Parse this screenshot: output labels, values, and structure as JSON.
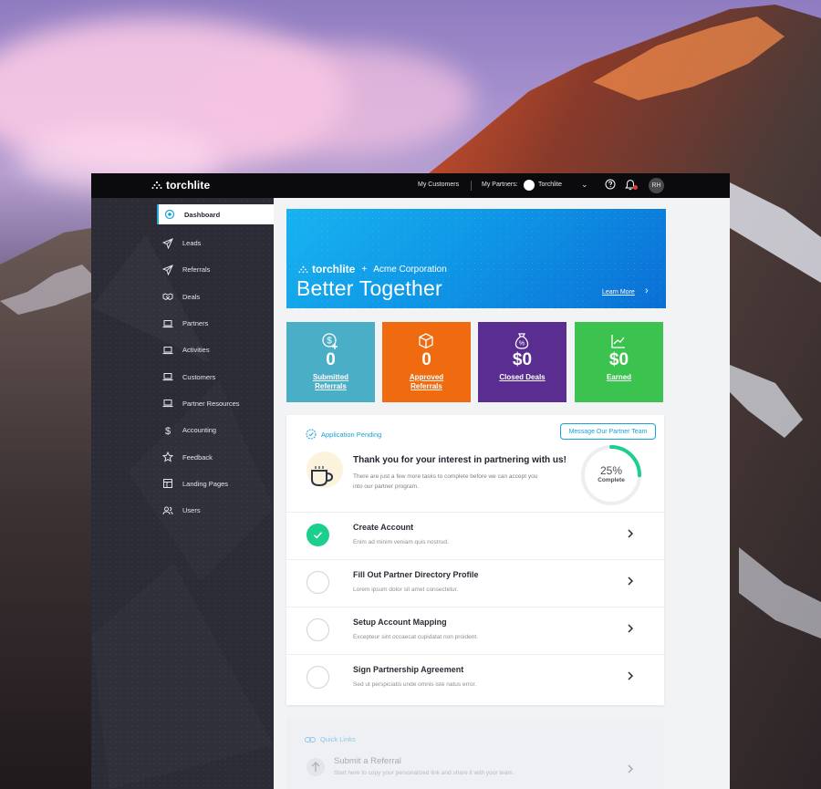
{
  "topbar": {
    "brand": "torchlite",
    "my_customers": "My Customers",
    "my_partners_label": "My Partners:",
    "partner_name": "Torchlite",
    "avatar_initials": "RH"
  },
  "sidebar": {
    "items": [
      {
        "label": "Dashboard",
        "icon": "dashboard-icon",
        "active": true
      },
      {
        "label": "Leads",
        "icon": "send-icon"
      },
      {
        "label": "Referrals",
        "icon": "send-icon"
      },
      {
        "label": "Deals",
        "icon": "handshake-icon"
      },
      {
        "label": "Partners",
        "icon": "laptop-icon"
      },
      {
        "label": "Activities",
        "icon": "laptop-icon"
      },
      {
        "label": "Customers",
        "icon": "laptop-icon"
      },
      {
        "label": "Partner Resources",
        "icon": "laptop-icon"
      },
      {
        "label": "Accounting",
        "icon": "dollar-icon"
      },
      {
        "label": "Feedback",
        "icon": "star-icon"
      },
      {
        "label": "Landing Pages",
        "icon": "layout-icon"
      },
      {
        "label": "Users",
        "icon": "users-icon"
      }
    ]
  },
  "banner": {
    "brand": "torchlite",
    "plus": "+",
    "partner": "Acme Corporation",
    "title": "Better Together",
    "learn_more": "Learn More"
  },
  "stats": [
    {
      "value": "0",
      "label": "Submitted Referrals",
      "color": "#4aaec6",
      "icon": "dollar-plus-icon"
    },
    {
      "value": "0",
      "label": "Approved Referrals",
      "color": "#f06a0f",
      "icon": "box-icon"
    },
    {
      "value": "$0",
      "label": "Closed Deals",
      "color": "#5a2d91",
      "icon": "money-bag-icon"
    },
    {
      "value": "$0",
      "label": "Earned",
      "color": "#3cc24f",
      "icon": "chart-icon"
    }
  ],
  "onboarding": {
    "status": "Application Pending",
    "message_button": "Message Our Partner Team",
    "title": "Thank you for your interest in partnering with us!",
    "subtitle": "There are just a few more tasks to complete before we can accept you into our partner program.",
    "progress_percent": 25,
    "progress_label": "25%",
    "progress_caption": "Complete",
    "tasks": [
      {
        "title": "Create Account",
        "desc": "Enim ad minim veniam quis nostrud.",
        "done": true
      },
      {
        "title": "Fill Out Partner Directory Profile",
        "desc": "Lorem ipsum dolor sit amet consectetur.",
        "done": false
      },
      {
        "title": "Setup Account Mapping",
        "desc": "Excepteur sint occaecat cupidatat non proident.",
        "done": false
      },
      {
        "title": "Sign Partnership Agreement",
        "desc": "Sed ut perspiciatis unde omnis iste natus error.",
        "done": false
      }
    ]
  },
  "quick_links": {
    "heading": "Quick Links",
    "item_title": "Submit a Referral",
    "item_desc": "Start here to copy your personalized link and share it with your team."
  },
  "colors": {
    "accent": "#16a3d8",
    "success": "#1ccf8d",
    "sidebar_bg": "#2c2c37",
    "topbar_bg": "#0b0b0d"
  }
}
